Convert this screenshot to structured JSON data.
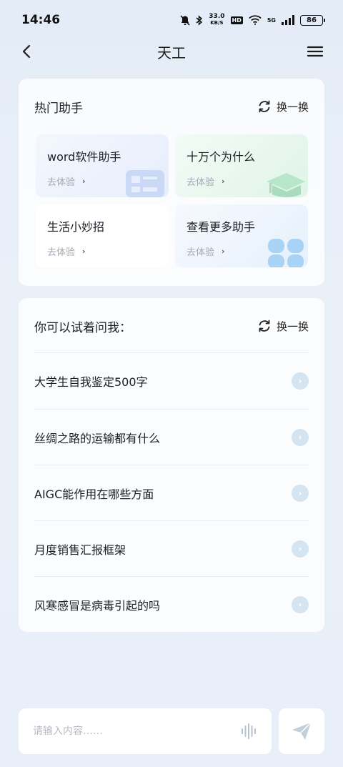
{
  "status_bar": {
    "time": "14:46",
    "net_speed_value": "33.0",
    "net_speed_unit": "KB/S",
    "hd": "HD",
    "network": "5G",
    "battery": "86"
  },
  "nav": {
    "title": "天工"
  },
  "hot_assistants": {
    "title": "热门助手",
    "refresh_label": "换一换",
    "items": [
      {
        "name": "word软件助手",
        "action": "去体验"
      },
      {
        "name": "十万个为什么",
        "action": "去体验"
      },
      {
        "name": "生活小妙招",
        "action": "去体验"
      },
      {
        "name": "查看更多助手",
        "action": "去体验"
      }
    ]
  },
  "suggestions": {
    "title": "你可以试着问我：",
    "refresh_label": "换一换",
    "items": [
      "大学生自我鉴定500字",
      "丝绸之路的运输都有什么",
      "AIGC能作用在哪些方面",
      "月度销售汇报框架",
      "风寒感冒是病毒引起的吗"
    ]
  },
  "composer": {
    "placeholder": "请输入内容……"
  },
  "colors": {
    "background": "#e6edf7",
    "card": "#ffffff",
    "arrow_circle": "#d4e4f1",
    "muted_text": "#a3a9b3"
  }
}
